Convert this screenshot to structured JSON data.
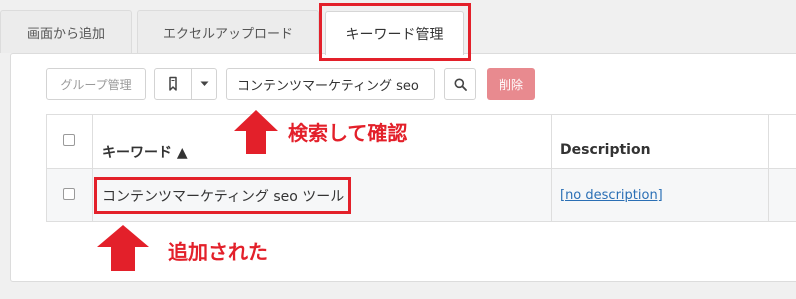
{
  "tabs": {
    "add_from_screen": "画面から追加",
    "excel_upload": "エクセルアップロード",
    "keyword_management": "キーワード管理"
  },
  "toolbar": {
    "group_management_label": "グループ管理",
    "search_value": "コンテンツマーケティング seo",
    "delete_label": "削除"
  },
  "table": {
    "headers": {
      "keyword": "キーワード ▲",
      "description": "Description"
    },
    "rows": [
      {
        "keyword": "コンテンツマーケティング seo ツール",
        "description": "[no description]"
      }
    ]
  },
  "annotations": {
    "search_confirm": "検索して確認",
    "added": "追加された"
  },
  "colors": {
    "highlight_red": "#e3202a",
    "delete_button": "#e88a8f",
    "link_blue": "#2a6fb5"
  },
  "icons": [
    "bookmark-icon",
    "caret-down-icon",
    "search-icon",
    "sort-asc-icon",
    "arrow-up-icon"
  ]
}
